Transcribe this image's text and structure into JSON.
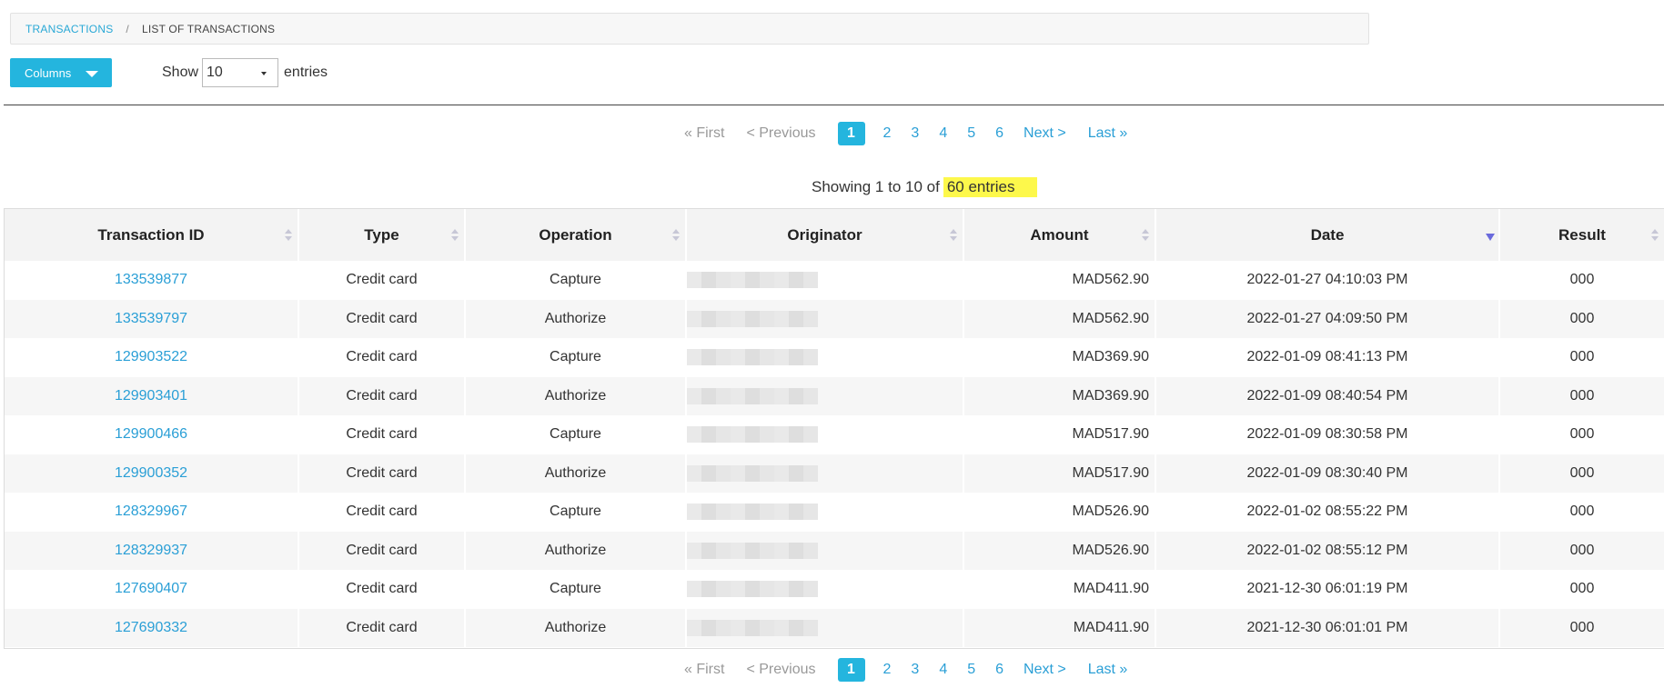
{
  "breadcrumb": {
    "root": "TRANSACTIONS",
    "separator": "/",
    "current": "LIST OF TRANSACTIONS"
  },
  "toolbar": {
    "columns_label": "Columns",
    "show_label": "Show",
    "entries_label": "entries",
    "page_size": "10"
  },
  "pager": {
    "first": "« First",
    "previous": "< Previous",
    "pages": [
      "1",
      "2",
      "3",
      "4",
      "5",
      "6"
    ],
    "active_page": "1",
    "next": "Next >",
    "last": "Last »"
  },
  "info": {
    "prefix": "Showing 1 to 10 of",
    "total": "60 entries"
  },
  "table": {
    "headers": [
      "Transaction ID",
      "Type",
      "Operation",
      "Originator",
      "Amount",
      "Date",
      "Result"
    ],
    "sorted_column": "Date",
    "sort_direction": "descending",
    "rows": [
      {
        "id": "133539877",
        "type": "Credit card",
        "operation": "Capture",
        "amount": "MAD562.90",
        "date": "2022-01-27 04:10:03 PM",
        "result": "000"
      },
      {
        "id": "133539797",
        "type": "Credit card",
        "operation": "Authorize",
        "amount": "MAD562.90",
        "date": "2022-01-27 04:09:50 PM",
        "result": "000"
      },
      {
        "id": "129903522",
        "type": "Credit card",
        "operation": "Capture",
        "amount": "MAD369.90",
        "date": "2022-01-09 08:41:13 PM",
        "result": "000"
      },
      {
        "id": "129903401",
        "type": "Credit card",
        "operation": "Authorize",
        "amount": "MAD369.90",
        "date": "2022-01-09 08:40:54 PM",
        "result": "000"
      },
      {
        "id": "129900466",
        "type": "Credit card",
        "operation": "Capture",
        "amount": "MAD517.90",
        "date": "2022-01-09 08:30:58 PM",
        "result": "000"
      },
      {
        "id": "129900352",
        "type": "Credit card",
        "operation": "Authorize",
        "amount": "MAD517.90",
        "date": "2022-01-09 08:30:40 PM",
        "result": "000"
      },
      {
        "id": "128329967",
        "type": "Credit card",
        "operation": "Capture",
        "amount": "MAD526.90",
        "date": "2022-01-02 08:55:22 PM",
        "result": "000"
      },
      {
        "id": "128329937",
        "type": "Credit card",
        "operation": "Authorize",
        "amount": "MAD526.90",
        "date": "2022-01-02 08:55:12 PM",
        "result": "000"
      },
      {
        "id": "127690407",
        "type": "Credit card",
        "operation": "Capture",
        "amount": "MAD411.90",
        "date": "2021-12-30 06:01:19 PM",
        "result": "000"
      },
      {
        "id": "127690332",
        "type": "Credit card",
        "operation": "Authorize",
        "amount": "MAD411.90",
        "date": "2021-12-30 06:01:01 PM",
        "result": "000"
      }
    ]
  },
  "colors": {
    "accent": "#24b5de",
    "link": "#2a9fd6",
    "highlight": "#fdf84b",
    "sort_active": "#6a6adc"
  }
}
